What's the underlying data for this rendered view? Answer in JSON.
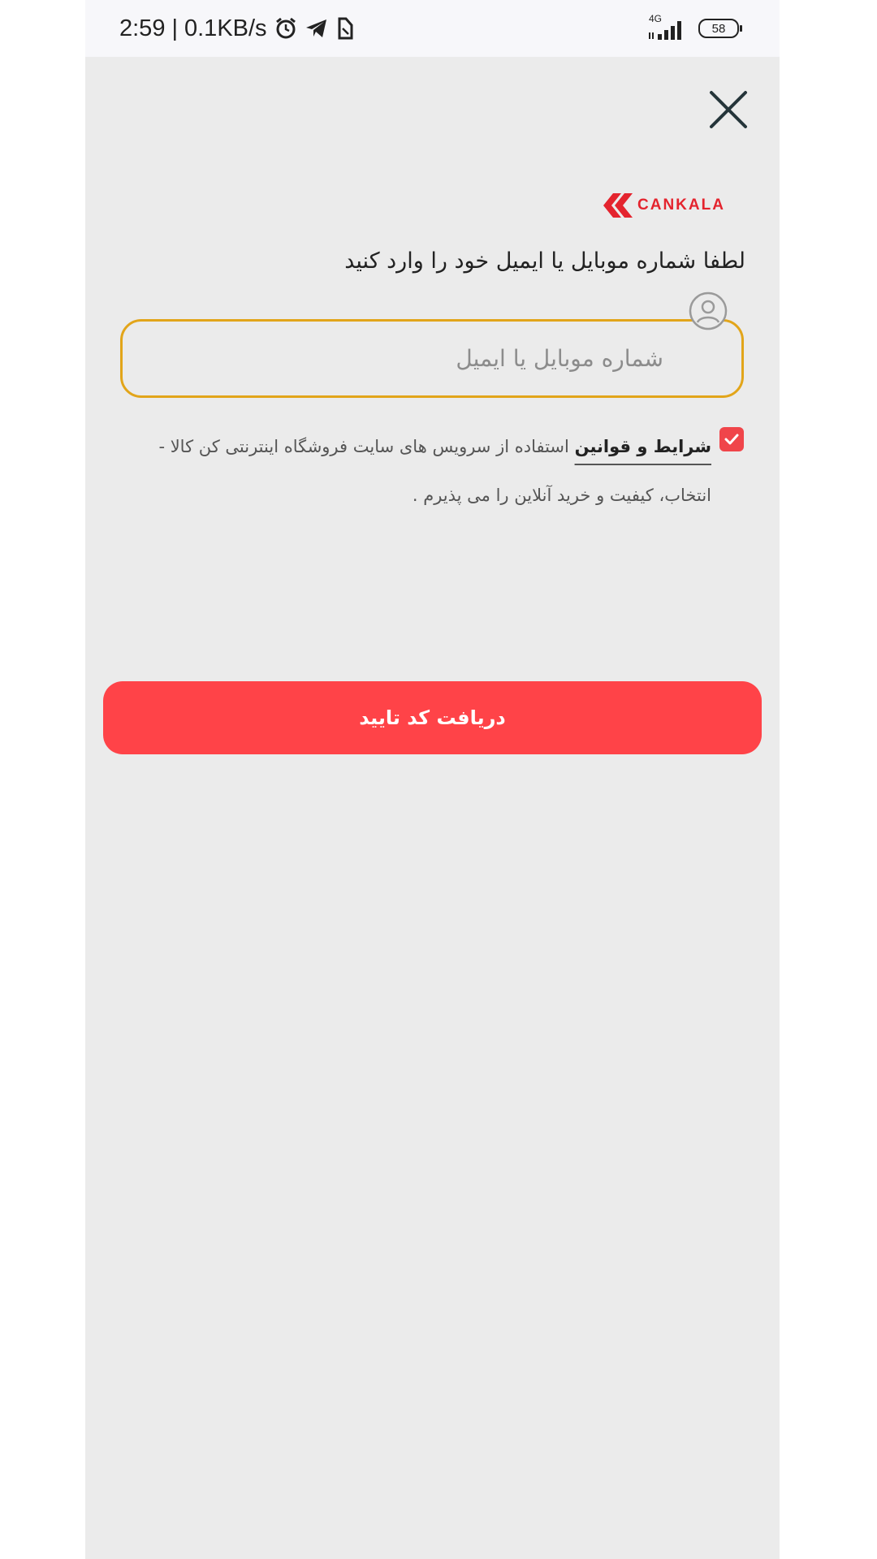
{
  "status_bar": {
    "time": "2:59",
    "separator": "|",
    "net_speed": "0.1KB/s",
    "network": "4G",
    "battery": "58"
  },
  "brand": {
    "logo_text": "CANKALA",
    "color": "#e4242e"
  },
  "login": {
    "title": "لطفا شماره موبایل یا ایمیل خود را وارد کنید",
    "input_placeholder": "شماره موبایل یا ایمیل",
    "input_value": "",
    "terms_checked": true,
    "terms_link": "شرایط و قوانین",
    "terms_text": "استفاده از سرویس های سایت فروشگاه اینترنتی کن کالا - انتخاب، کیفیت و خرید آنلاین را می پذیرم .",
    "submit_label": "دریافت کد تایید"
  },
  "colors": {
    "primary": "#ff4348",
    "input_border": "#e2a51a",
    "background": "#ebebeb"
  }
}
